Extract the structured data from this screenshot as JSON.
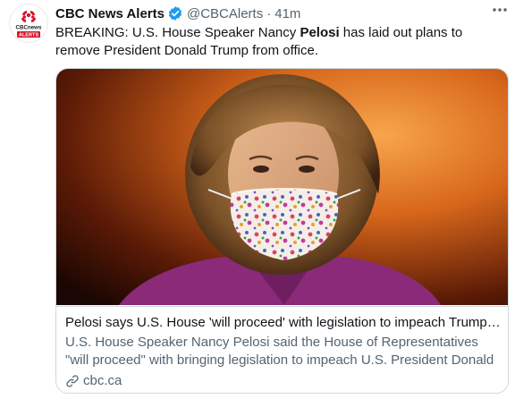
{
  "tweet": {
    "author_name": "CBC News Alerts",
    "handle": "@CBCAlerts",
    "separator": "·",
    "time": "41m",
    "avatar": {
      "brand_text": "CBCnews",
      "badge_text": "ALERTS",
      "brand_color": "#d6142b"
    },
    "text_before": "BREAKING: U.S. House Speaker Nancy ",
    "text_bold": "Pelosi",
    "text_after": " has laid out plans to remove President Donald Trump from office."
  },
  "card": {
    "image": "photo-nancy-pelosi-wearing-floral-mask",
    "title": "Pelosi says U.S. House 'will proceed' with legislation to impeach Trump f...",
    "description": "U.S. House Speaker Nancy Pelosi said the House of Representatives \"will proceed\" with bringing legislation to impeach U.S. President Donald ...",
    "domain": "cbc.ca"
  },
  "colors": {
    "verified": "#1d9bf0",
    "secondary_text": "#536471",
    "border": "#cfd9de"
  }
}
